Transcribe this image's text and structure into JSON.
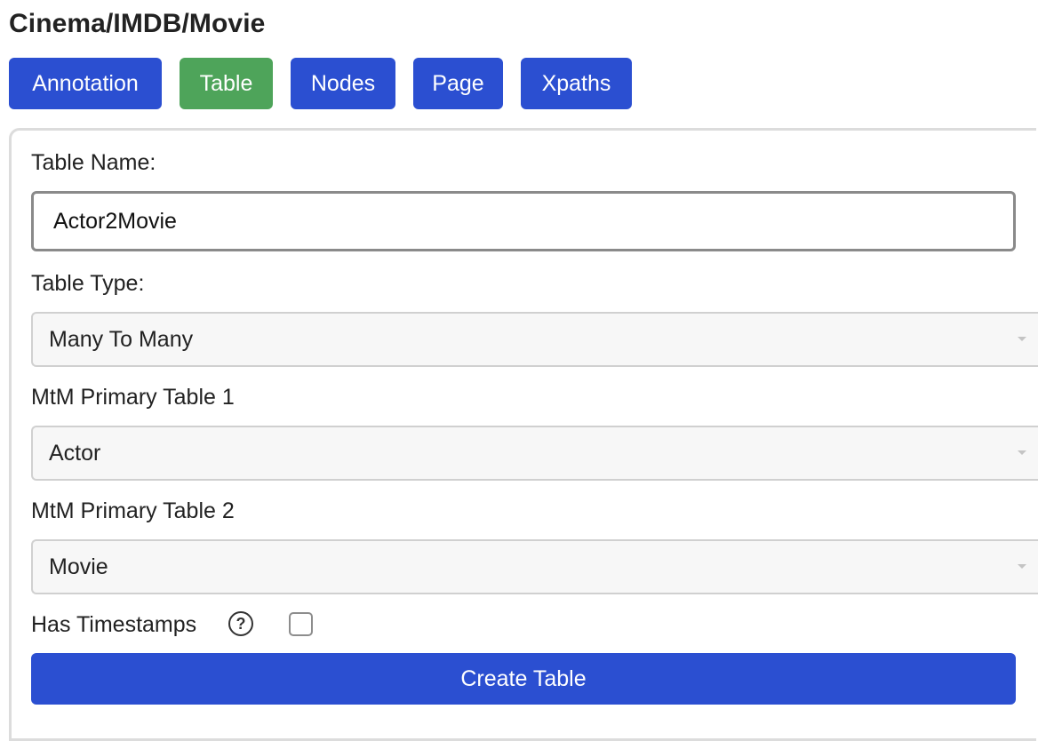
{
  "header": {
    "title": "Cinema/IMDB/Movie"
  },
  "tabs": [
    {
      "label": "Annotation",
      "active": false
    },
    {
      "label": "Table",
      "active": true
    },
    {
      "label": "Nodes",
      "active": false
    },
    {
      "label": "Page",
      "active": false
    },
    {
      "label": "Xpaths",
      "active": false
    }
  ],
  "form": {
    "table_name_label": "Table Name:",
    "table_name_value": "Actor2Movie",
    "table_type_label": "Table Type:",
    "table_type_value": "Many To Many",
    "mtm_primary_1_label": "MtM Primary Table 1",
    "mtm_primary_1_value": "Actor",
    "mtm_primary_2_label": "MtM Primary Table 2",
    "mtm_primary_2_value": "Movie",
    "timestamps_label": "Has Timestamps",
    "timestamps_help_icon": "question-circle-icon",
    "timestamps_help_glyph": "?",
    "timestamps_checked": false,
    "create_button_label": "Create Table"
  },
  "colors": {
    "primary": "#2b4fd1",
    "active_tab": "#4ea45a",
    "select_bg": "#f7f7f7",
    "panel_border": "#dcdcdc"
  }
}
